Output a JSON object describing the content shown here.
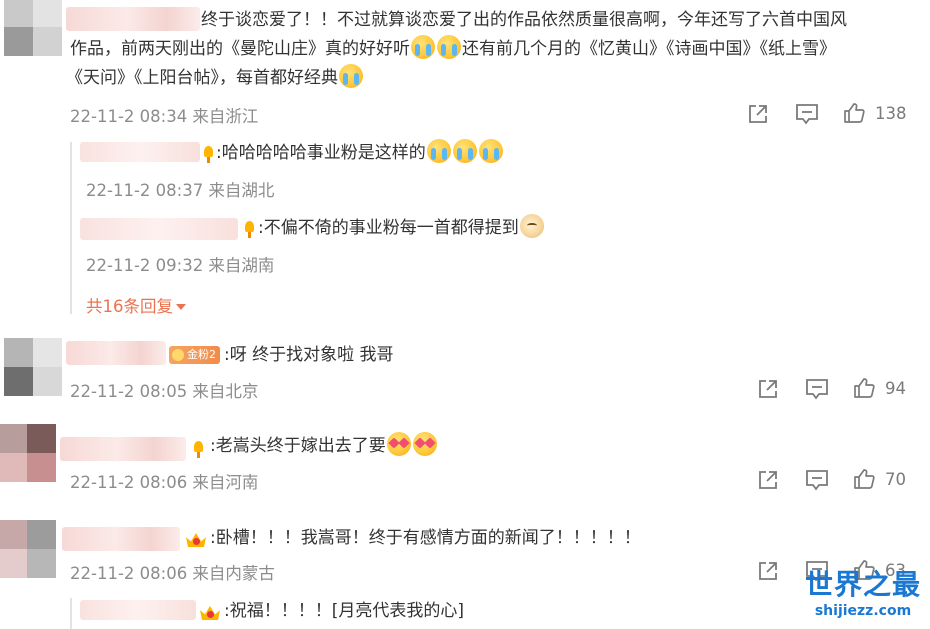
{
  "comments": [
    {
      "text_lines": [
        "终于谈恋爱了！！不过就算谈恋爱了出的作品依然质量很高啊，今年还写了六首中国风",
        "作品，前两天刚出的《曼陀山庄》真的好好听",
        "还有前几个月的《忆黄山》《诗画中国》《纸上雪》",
        "《天问》《上阳台帖》，每首都好经典"
      ],
      "meta": "22-11-2 08:34 来自浙江",
      "likes": "138",
      "replies": [
        {
          "text": ":哈哈哈哈哈事业粉是这样的",
          "meta": "22-11-2 08:37 来自湖北"
        },
        {
          "text": ":不偏不倚的事业粉每一首都得提到",
          "meta": "22-11-2 09:32 来自湖南"
        }
      ],
      "more_replies": "共16条回复"
    },
    {
      "badge": "金粉2",
      "text": ":呀  终于找对象啦 我哥",
      "meta": "22-11-2 08:05 来自北京",
      "likes": "94"
    },
    {
      "text": ":老嵩头终于嫁出去了要",
      "meta": "22-11-2 08:06 来自河南",
      "likes": "70"
    },
    {
      "text": ":卧槽！！！我嵩哥！终于有感情方面的新闻了！！！！！",
      "meta": "22-11-2 08:06 来自内蒙古",
      "likes": "63"
    },
    {
      "text": ":祝福！！！！[月亮代表我的心]"
    }
  ],
  "icons": {
    "share": "share-icon",
    "comment": "comment-icon",
    "like": "thumbs-up-icon"
  },
  "colors": {
    "accent": "#eb7350",
    "meta": "#8c8c8c",
    "watermark": "#1b78d2"
  },
  "watermark": {
    "title": "世界之最",
    "subtitle": "shijiezz.com"
  }
}
